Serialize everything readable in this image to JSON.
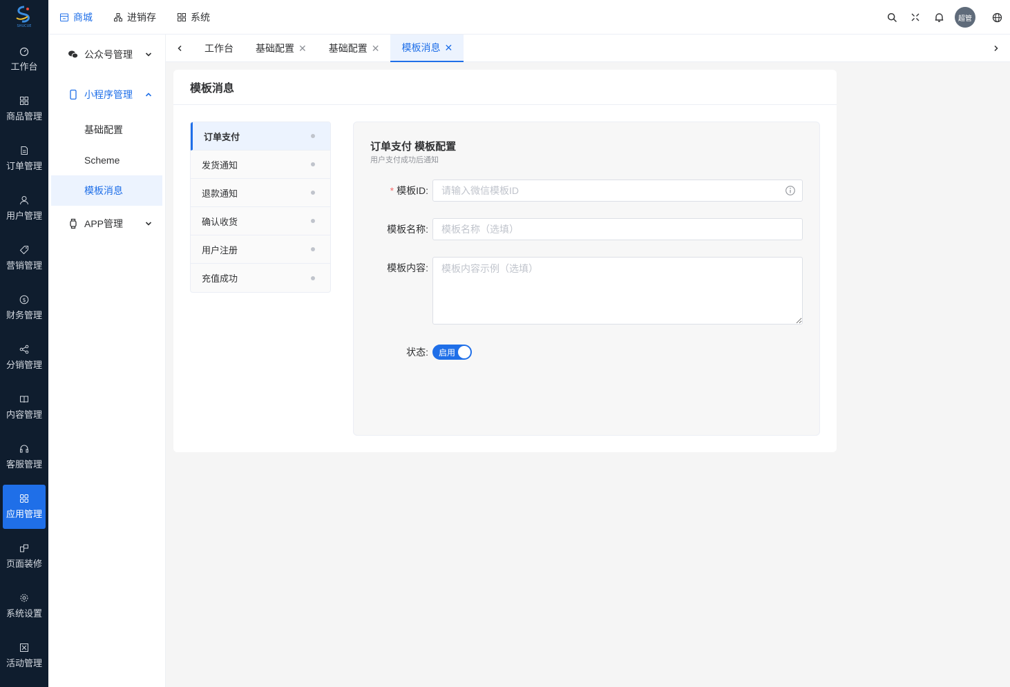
{
  "logo": {
    "text": "SHUCUE"
  },
  "rail": {
    "items": [
      {
        "label": "工作台",
        "icon": "dashboard-icon"
      },
      {
        "label": "商品管理",
        "icon": "grid-icon"
      },
      {
        "label": "订单管理",
        "icon": "document-icon"
      },
      {
        "label": "用户管理",
        "icon": "user-icon"
      },
      {
        "label": "营销管理",
        "icon": "tag-icon"
      },
      {
        "label": "财务管理",
        "icon": "dollar-icon"
      },
      {
        "label": "分销管理",
        "icon": "share-icon"
      },
      {
        "label": "内容管理",
        "icon": "book-icon"
      },
      {
        "label": "客服管理",
        "icon": "headset-icon"
      },
      {
        "label": "应用管理",
        "icon": "apps-icon",
        "active": true
      },
      {
        "label": "页面装修",
        "icon": "layout-icon"
      },
      {
        "label": "系统设置",
        "icon": "gear-icon"
      },
      {
        "label": "活动管理",
        "icon": "activity-icon"
      }
    ]
  },
  "topnav": {
    "items": [
      {
        "label": "商城",
        "icon": "store-icon",
        "active": true
      },
      {
        "label": "进销存",
        "icon": "hierarchy-icon"
      },
      {
        "label": "系统",
        "icon": "apps-icon"
      }
    ],
    "avatar_text": "超管"
  },
  "submenu": {
    "groups": [
      {
        "label": "公众号管理",
        "icon": "wechat-icon"
      },
      {
        "label": "小程序管理",
        "icon": "phone-icon",
        "children": [
          "基础配置",
          "Scheme",
          "模板消息"
        ],
        "active_child": "模板消息"
      },
      {
        "label": "APP管理",
        "icon": "watch-icon"
      }
    ]
  },
  "tabs": [
    {
      "label": "工作台",
      "closable": false
    },
    {
      "label": "基础配置",
      "closable": true
    },
    {
      "label": "基础配置",
      "closable": true
    },
    {
      "label": "模板消息",
      "closable": true,
      "active": true
    }
  ],
  "card": {
    "title": "模板消息",
    "templates": [
      "订单支付",
      "发货通知",
      "退款通知",
      "确认收货",
      "用户注册",
      "充值成功"
    ],
    "active_template": "订单支付",
    "panel": {
      "title": "订单支付 模板配置",
      "subtitle": "用户支付成功后通知",
      "fields": {
        "template_id": {
          "label": "模板ID:",
          "placeholder": "请输入微信模板ID",
          "required": true
        },
        "template_name": {
          "label": "模板名称:",
          "placeholder": "模板名称（选填）"
        },
        "template_content": {
          "label": "模板内容:",
          "placeholder": "模板内容示例（选填）"
        },
        "status": {
          "label": "状态:",
          "value": "启用"
        }
      }
    }
  },
  "colors": {
    "accent": "#1f6fe8",
    "rail_bg": "#0f1d2e"
  }
}
